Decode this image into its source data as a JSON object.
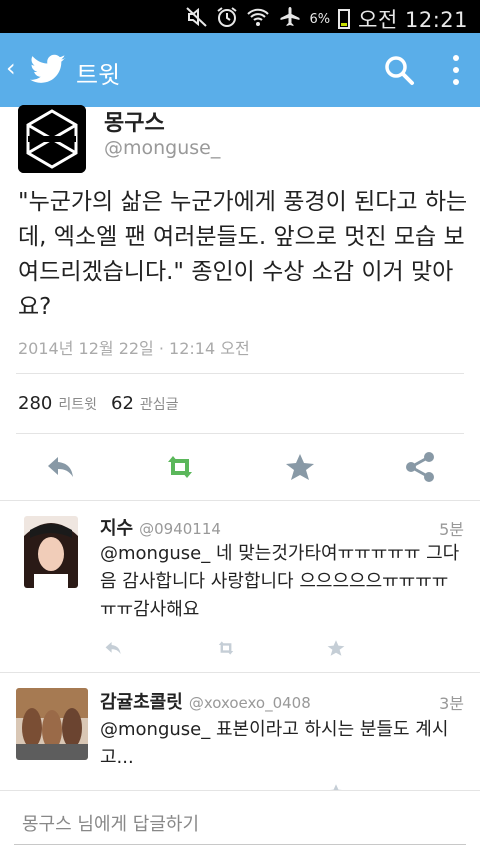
{
  "status_bar": {
    "battery_percent": "6%",
    "time": "오전 12:21"
  },
  "app_bar": {
    "title": "트윗",
    "back_icon": "‹"
  },
  "tweet": {
    "author_name": "몽구스",
    "author_handle": "@monguse_",
    "text": "\"누군가의 삶은 누군가에게 풍경이 된다고 하는데, 엑소엘 팬 여러분들도. 앞으로 멋진 모습 보여드리겠습니다.\" 종인이 수상 소감 이거 맞아요?",
    "timestamp": "2014년 12월 22일 · 12:14 오전",
    "retweet_count": "280",
    "retweet_label": "리트윗",
    "favorite_count": "62",
    "favorite_label": "관심글"
  },
  "replies": [
    {
      "name": "지수",
      "handle": "@0940114",
      "time": "5분",
      "text": "@monguse_ 네 맞는것가타여ㅠㅠㅠㅠㅠ 그다음 감사합니다 사랑합니다 으으으으으ㅠㅠㅠㅠㅠㅠ감사해요"
    },
    {
      "name": "감귤초콜릿",
      "handle": "@xoxoexo_0408",
      "time": "3분",
      "text": "@monguse_ 표본이라고 하시는 분들도 계시고..."
    }
  ],
  "composer": {
    "placeholder": "몽구스 님에게 답글하기"
  },
  "colors": {
    "app_bar": "#5aaee9",
    "retweet_green": "#5bb75b",
    "icon_gray": "#8899a6"
  }
}
